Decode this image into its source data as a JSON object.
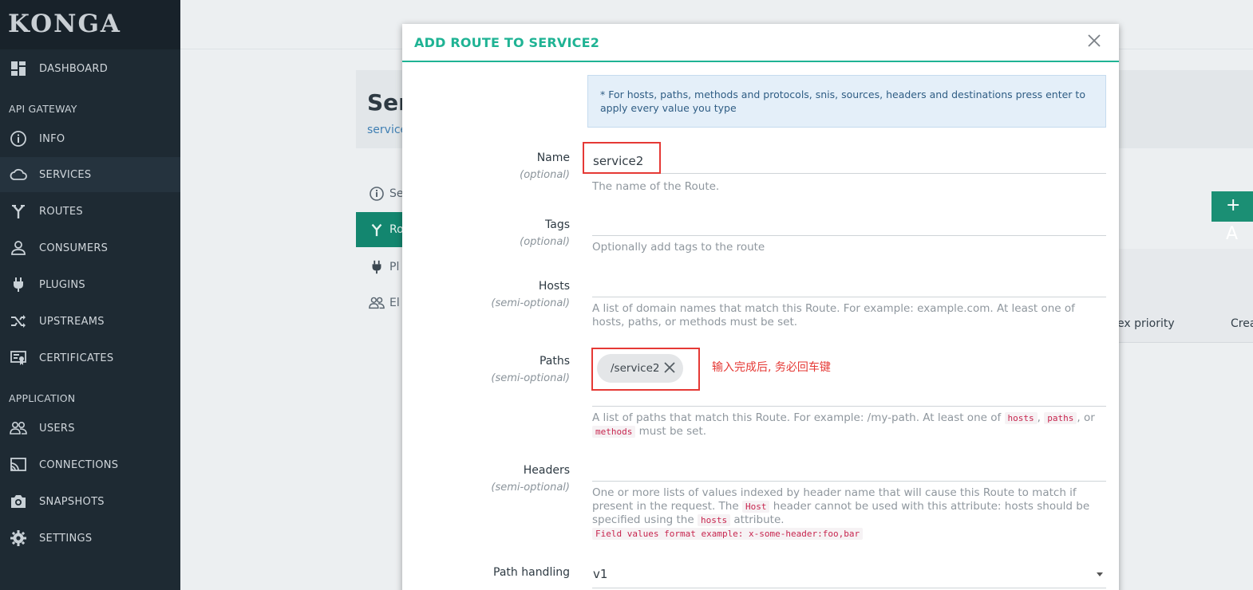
{
  "brand": "KONGA",
  "sidebar": {
    "top_items": [
      {
        "label": "DASHBOARD",
        "icon": "dashboard-icon"
      }
    ],
    "sections": [
      {
        "title": "API GATEWAY",
        "items": [
          {
            "label": "INFO",
            "icon": "info-icon"
          },
          {
            "label": "SERVICES",
            "icon": "cloud-icon",
            "active": true
          },
          {
            "label": "ROUTES",
            "icon": "routes-icon"
          },
          {
            "label": "CONSUMERS",
            "icon": "user-icon"
          },
          {
            "label": "PLUGINS",
            "icon": "plug-icon"
          },
          {
            "label": "UPSTREAMS",
            "icon": "shuffle-icon"
          },
          {
            "label": "CERTIFICATES",
            "icon": "certificate-icon"
          }
        ]
      },
      {
        "title": "APPLICATION",
        "items": [
          {
            "label": "USERS",
            "icon": "users-icon"
          },
          {
            "label": "CONNECTIONS",
            "icon": "cast-icon"
          },
          {
            "label": "SNAPSHOTS",
            "icon": "camera-icon"
          },
          {
            "label": "SETTINGS",
            "icon": "gear-icon"
          }
        ]
      }
    ]
  },
  "background_page": {
    "title": "Ser",
    "subtitle": "service",
    "tabs": [
      {
        "label": "Se",
        "icon": "info-icon"
      },
      {
        "label": "Ro",
        "icon": "routes-icon",
        "active": true
      },
      {
        "label": "Pl",
        "icon": "plug-icon"
      },
      {
        "label": "El",
        "icon": "users-icon"
      }
    ],
    "add_button": "+ A",
    "table_columns": [
      "ex priority",
      "Crea"
    ]
  },
  "modal": {
    "title": "ADD ROUTE TO SERVICE2",
    "close_icon": "close-icon",
    "info_text": "* For hosts, paths, methods and protocols, snis, sources, headers and destinations press enter to apply every value you type",
    "fields": {
      "name": {
        "label": "Name",
        "sub": "(optional)",
        "value": "service2",
        "help": "The name of the Route."
      },
      "tags": {
        "label": "Tags",
        "sub": "(optional)",
        "value": "",
        "help": "Optionally add tags to the route"
      },
      "hosts": {
        "label": "Hosts",
        "sub": "(semi-optional)",
        "value": "",
        "help": "A list of domain names that match this Route. For example: example.com. At least one of hosts, paths, or methods must be set."
      },
      "paths": {
        "label": "Paths",
        "sub": "(semi-optional)",
        "chip": "/service2",
        "help_prefix": "A list of paths that match this Route. For example: /my-path. At least one of",
        "code1": "hosts",
        "sep1": ",",
        "code2": "paths",
        "sep2": ", or",
        "code3": "methods",
        "help_suffix": "must be set."
      },
      "headers": {
        "label": "Headers",
        "sub": "(semi-optional)",
        "help_prefix": "One or more lists of values indexed by header name that will cause this Route to match if present in the request. The",
        "code1": "Host",
        "help_mid": "header cannot be used with this attribute: hosts should be specified using the",
        "code2": "hosts",
        "help_suffix": "attribute.",
        "example": "Field values format example: x-some-header:foo,bar"
      },
      "path_handling": {
        "label": "Path handling",
        "value": "v1"
      }
    },
    "annotation": "输入完成后, 务必回车键"
  },
  "colors": {
    "sidebar_bg": "#1e2a33",
    "accent": "#1fb394",
    "highlight": "#e53935",
    "info_bg": "#e4eff9"
  }
}
